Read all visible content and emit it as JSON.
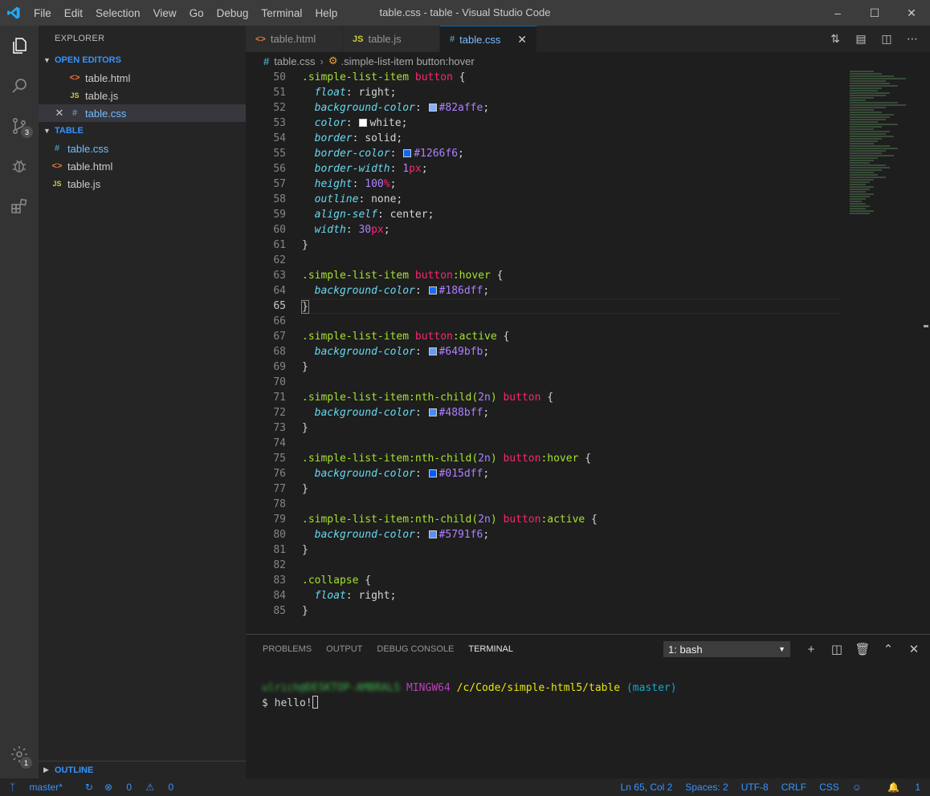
{
  "window": {
    "title": "table.css - table - Visual Studio Code",
    "menu": [
      "File",
      "Edit",
      "Selection",
      "View",
      "Go",
      "Debug",
      "Terminal",
      "Help"
    ]
  },
  "sidebar": {
    "header": "EXPLORER",
    "open_editors_label": "OPEN EDITORS",
    "open_editors": [
      {
        "name": "table.html",
        "icon": "<>"
      },
      {
        "name": "table.js",
        "icon": "JS"
      },
      {
        "name": "table.css",
        "icon": "#"
      }
    ],
    "folder_label": "TABLE",
    "files": [
      {
        "name": "table.css",
        "icon": "#"
      },
      {
        "name": "table.html",
        "icon": "<>"
      },
      {
        "name": "table.js",
        "icon": "JS"
      }
    ],
    "outline_label": "OUTLINE"
  },
  "activity": {
    "scm_badge": "3",
    "settings_badge": "1"
  },
  "tabs": [
    {
      "name": "table.html",
      "icon": "<>"
    },
    {
      "name": "table.js",
      "icon": "JS"
    },
    {
      "name": "table.css",
      "icon": "#"
    }
  ],
  "breadcrumb": {
    "file": "table.css",
    "symbol": ".simple-list-item button:hover"
  },
  "editor": {
    "line_numbers": [
      "50",
      "51",
      "52",
      "53",
      "54",
      "55",
      "56",
      "57",
      "58",
      "59",
      "60",
      "61",
      "62",
      "63",
      "64",
      "65",
      "66",
      "67",
      "68",
      "69",
      "70",
      "71",
      "72",
      "73",
      "74",
      "75",
      "76",
      "77",
      "78",
      "79",
      "80",
      "81",
      "82",
      "83",
      "84",
      "85"
    ],
    "current_line": "65",
    "lines": {
      "l50": {
        "sel": ".simple-list-item",
        "tag": "button",
        "end": " {"
      },
      "l51": {
        "prop": "float",
        "val": "right"
      },
      "l52": {
        "prop": "background-color",
        "hex": "#82affe"
      },
      "l53": {
        "prop": "color",
        "val": "white"
      },
      "l54": {
        "prop": "border",
        "val": "solid"
      },
      "l55": {
        "prop": "border-color",
        "hex": "#1266f6"
      },
      "l56": {
        "prop": "border-width",
        "num": "1",
        "unit": "px"
      },
      "l57": {
        "prop": "height",
        "num": "100",
        "unit": "%"
      },
      "l58": {
        "prop": "outline",
        "val": "none"
      },
      "l59": {
        "prop": "align-self",
        "val": "center"
      },
      "l60": {
        "prop": "width",
        "num": "30",
        "unit": "px"
      },
      "l63": {
        "sel": ".simple-list-item",
        "tag": "button",
        "pseudo": ":hover",
        "end": " {"
      },
      "l64": {
        "prop": "background-color",
        "hex": "#186dff"
      },
      "l67": {
        "sel": ".simple-list-item",
        "tag": "button",
        "pseudo": ":active",
        "end": " {"
      },
      "l68": {
        "prop": "background-color",
        "hex": "#649bfb"
      },
      "l71": {
        "sel": ".simple-list-item:nth-child(",
        "num": "2n",
        "sel2": ")",
        "tag": "button",
        "end": " {"
      },
      "l72": {
        "prop": "background-color",
        "hex": "#488bff"
      },
      "l75": {
        "sel": ".simple-list-item:nth-child(",
        "num": "2n",
        "sel2": ")",
        "tag": "button",
        "pseudo": ":hover",
        "end": " {"
      },
      "l76": {
        "prop": "background-color",
        "hex": "#015dff"
      },
      "l79": {
        "sel": ".simple-list-item:nth-child(",
        "num": "2n",
        "sel2": ")",
        "tag": "button",
        "pseudo": ":active",
        "end": " {"
      },
      "l80": {
        "prop": "background-color",
        "hex": "#5791f6"
      },
      "l83": {
        "sel": ".collapse",
        "end": " {"
      },
      "l84": {
        "prop": "float",
        "val": "right"
      }
    },
    "swatches": {
      "l52": "#82affe",
      "l53": "#ffffff",
      "l55": "#1266f6",
      "l64": "#186dff",
      "l68": "#649bfb",
      "l72": "#488bff",
      "l76": "#015dff",
      "l80": "#5791f6"
    }
  },
  "panel": {
    "tabs": [
      "PROBLEMS",
      "OUTPUT",
      "DEBUG CONSOLE",
      "TERMINAL"
    ],
    "active_tab": "TERMINAL",
    "shell": "1: bash",
    "terminal": {
      "user": "ulrich@DESKTOP-AMBRALS",
      "env": "MINGW64",
      "path": "/c/Code/simple-html5/table",
      "branch": "(master)",
      "command": "$ hello!"
    }
  },
  "status": {
    "branch": "master*",
    "errors": "0",
    "warnings": "0",
    "position": "Ln 65, Col 2",
    "spaces": "Spaces: 2",
    "encoding": "UTF-8",
    "eol": "CRLF",
    "language": "CSS",
    "notifications": "1"
  }
}
